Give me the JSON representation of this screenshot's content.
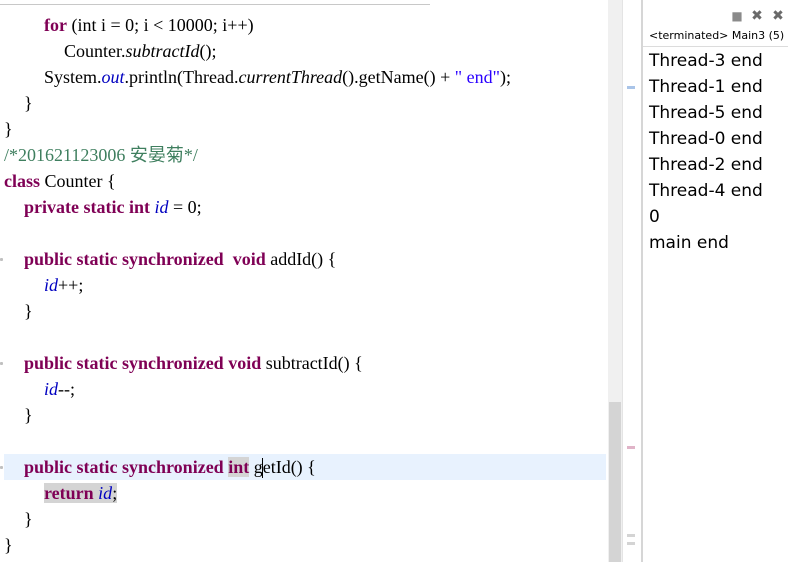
{
  "editor": {
    "lines": [
      {
        "parts": [
          {
            "k": "kw",
            "t": "for"
          },
          {
            "t": " (int i = 0; i < 10000; i++)"
          }
        ]
      },
      {
        "parts": [
          {
            "t": "Counter."
          },
          {
            "k": "it",
            "t": "subtractId"
          },
          {
            "t": "();"
          }
        ]
      },
      {
        "parts": [
          {
            "t": "System."
          },
          {
            "k": "fld",
            "t": "out"
          },
          {
            "t": ".println(Thread."
          },
          {
            "k": "it",
            "t": "currentThread"
          },
          {
            "t": "().getName() + "
          },
          {
            "k": "str",
            "t": "\" end\""
          },
          {
            "t": ");"
          }
        ]
      },
      {
        "parts": [
          {
            "t": "}"
          }
        ]
      },
      {
        "parts": [
          {
            "t": "}"
          }
        ]
      },
      {
        "parts": [
          {
            "k": "cm",
            "t": "/*201621123006 安晏菊*/"
          }
        ]
      },
      {
        "parts": [
          {
            "k": "kw",
            "t": "class"
          },
          {
            "t": " Counter {"
          }
        ]
      },
      {
        "parts": [
          {
            "k": "kw",
            "t": "private static int "
          },
          {
            "k": "fld",
            "t": "id"
          },
          {
            "t": " = 0;"
          }
        ]
      },
      {
        "parts": []
      },
      {
        "parts": [
          {
            "k": "kw",
            "t": "public static synchronized  void"
          },
          {
            "t": " addId() {"
          }
        ]
      },
      {
        "parts": [
          {
            "k": "fld",
            "t": "id"
          },
          {
            "t": "++;"
          }
        ]
      },
      {
        "parts": [
          {
            "t": "}"
          }
        ]
      },
      {
        "parts": []
      },
      {
        "parts": [
          {
            "k": "kw",
            "t": "public static synchronized void"
          },
          {
            "t": " subtractId() {"
          }
        ]
      },
      {
        "parts": [
          {
            "k": "fld",
            "t": "id"
          },
          {
            "t": "--;"
          }
        ]
      },
      {
        "parts": [
          {
            "t": "}"
          }
        ]
      },
      {
        "parts": []
      },
      {
        "parts": [
          {
            "k": "kw",
            "t": "public static synchronized "
          },
          {
            "k": "kw hl-token",
            "t": "int"
          },
          {
            "t": " getId() {"
          }
        ]
      },
      {
        "parts": [
          {
            "k": "kw hl-token",
            "t": "return"
          },
          {
            "k": "hl-token",
            "t": " "
          },
          {
            "k": "fld hl-token",
            "t": "id"
          },
          {
            "k": "hl-token",
            "t": ";"
          }
        ]
      },
      {
        "parts": [
          {
            "t": "}"
          }
        ]
      },
      {
        "parts": [
          {
            "t": "}"
          }
        ]
      }
    ]
  },
  "console": {
    "title": "<terminated> Main3 (5)",
    "output": [
      "Thread-3 end",
      "Thread-1 end",
      "Thread-5 end",
      "Thread-0 end",
      "Thread-2 end",
      "Thread-4 end",
      "0",
      "main end"
    ]
  },
  "icons": {
    "terminate": "terminate-icon",
    "remove_launch": "remove-launch-icon",
    "remove_all": "remove-all-launches-icon"
  },
  "colors": {
    "keyword": "#7f0055",
    "field": "#0000c0",
    "string": "#2a00ff",
    "comment": "#3f7f5f",
    "current_line": "#e8f2fe"
  }
}
